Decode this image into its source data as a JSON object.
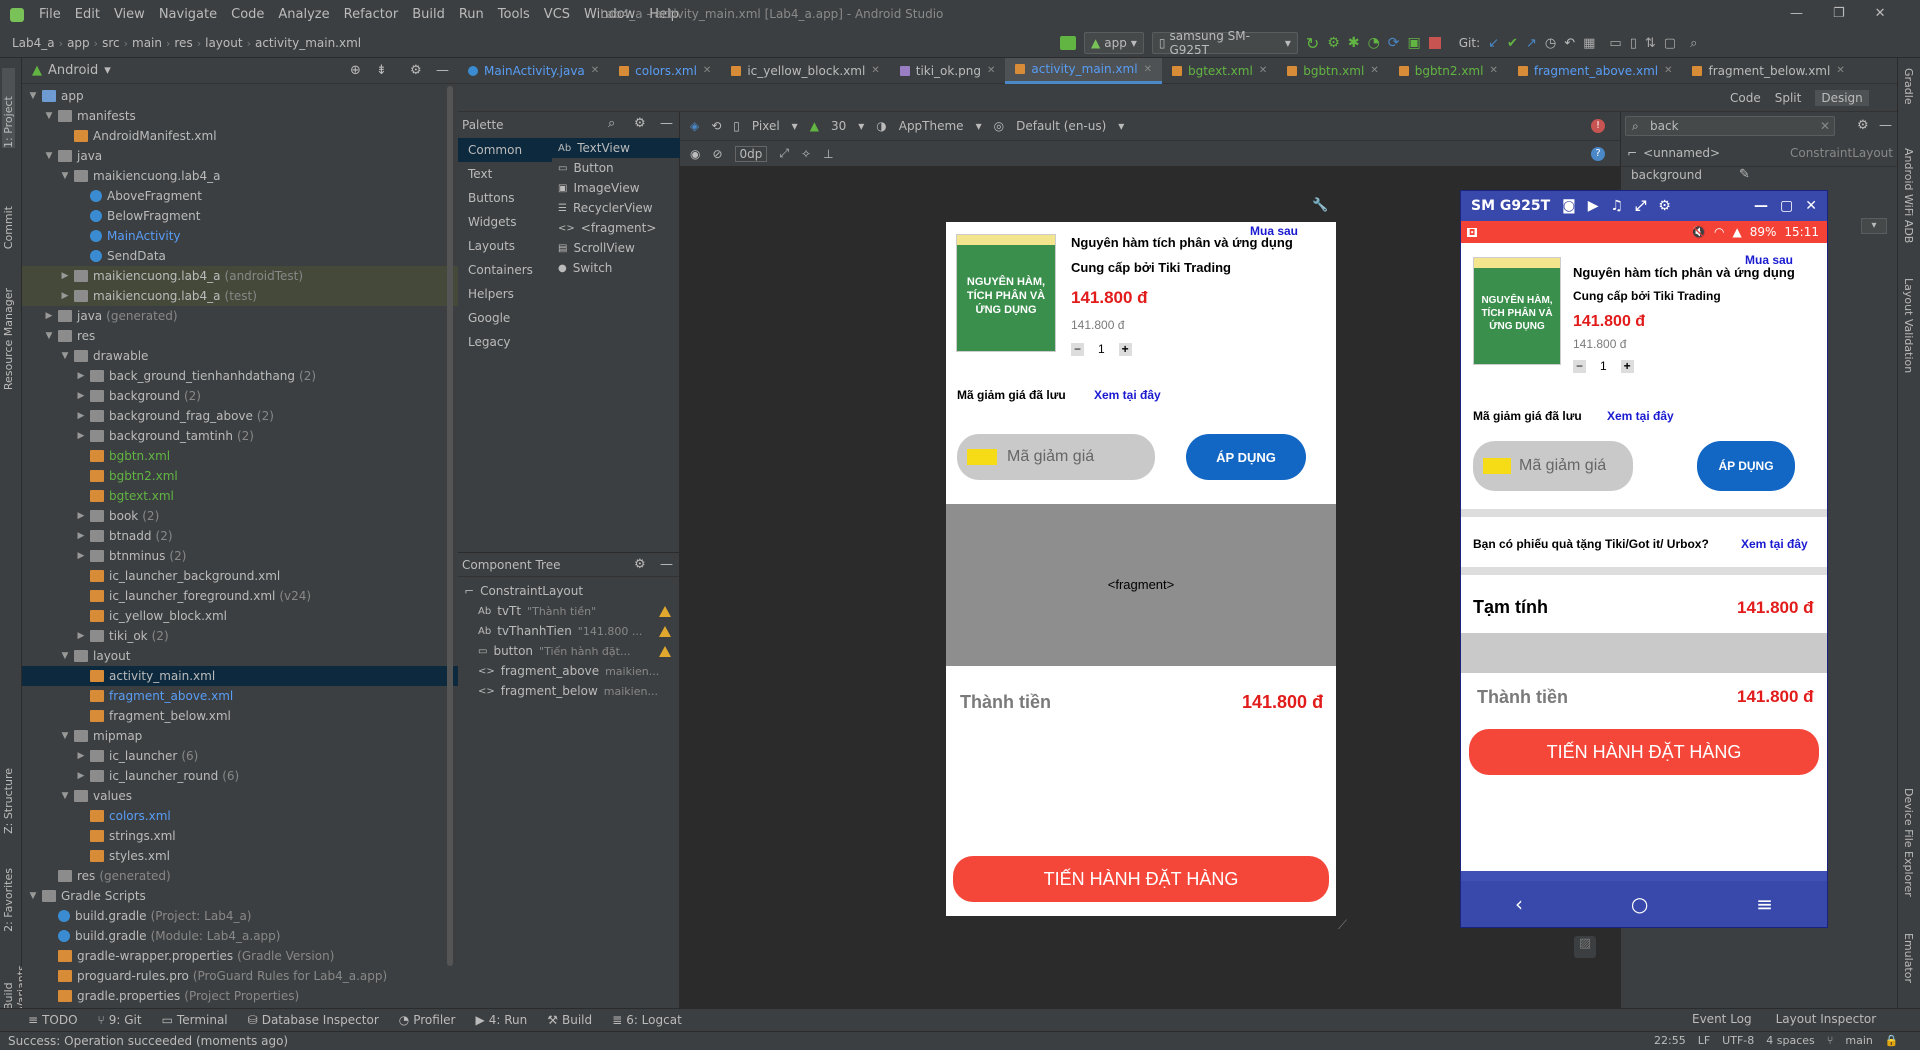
{
  "menu": [
    "File",
    "Edit",
    "View",
    "Navigate",
    "Code",
    "Analyze",
    "Refactor",
    "Build",
    "Run",
    "Tools",
    "VCS",
    "Window",
    "Help"
  ],
  "window_title": "Lab4_a - activity_main.xml [Lab4_a.app] - Android Studio",
  "breadcrumb": [
    "Lab4_a",
    "app",
    "src",
    "main",
    "res",
    "layout",
    "activity_main.xml"
  ],
  "toolbar": {
    "config": "app",
    "device": "samsung SM-G925T",
    "git": "Git:"
  },
  "project": {
    "view": "Android"
  },
  "tree": [
    {
      "d": 0,
      "a": "▼",
      "i": "fold blue",
      "t": "app",
      "n": ""
    },
    {
      "d": 1,
      "a": "▼",
      "i": "fold",
      "t": "manifests",
      "n": ""
    },
    {
      "d": 2,
      "a": "",
      "i": "xml",
      "t": "AndroidManifest.xml",
      "n": ""
    },
    {
      "d": 1,
      "a": "▼",
      "i": "fold",
      "t": "java",
      "n": ""
    },
    {
      "d": 2,
      "a": "▼",
      "i": "fold",
      "t": "maikiencuong.lab4_a",
      "n": ""
    },
    {
      "d": 3,
      "a": "",
      "i": "cls",
      "t": "AboveFragment",
      "n": ""
    },
    {
      "d": 3,
      "a": "",
      "i": "cls",
      "t": "BelowFragment",
      "n": ""
    },
    {
      "d": 3,
      "a": "",
      "i": "cls",
      "t": "MainActivity",
      "n": "",
      "c": "#589df6"
    },
    {
      "d": 3,
      "a": "",
      "i": "cls",
      "t": "SendData",
      "n": ""
    },
    {
      "d": 2,
      "a": "▶",
      "i": "fold",
      "t": "maikiencuong.lab4_a",
      "n": "(androidTest)",
      "bg": "#45493a"
    },
    {
      "d": 2,
      "a": "▶",
      "i": "fold",
      "t": "maikiencuong.lab4_a",
      "n": "(test)",
      "bg": "#45493a"
    },
    {
      "d": 1,
      "a": "▶",
      "i": "fold",
      "t": "java",
      "n": "(generated)"
    },
    {
      "d": 1,
      "a": "▼",
      "i": "fold",
      "t": "res",
      "n": ""
    },
    {
      "d": 2,
      "a": "▼",
      "i": "fold",
      "t": "drawable",
      "n": ""
    },
    {
      "d": 3,
      "a": "▶",
      "i": "fold",
      "t": "back_ground_tienhanhdathang",
      "n": "(2)"
    },
    {
      "d": 3,
      "a": "▶",
      "i": "fold",
      "t": "background",
      "n": "(2)"
    },
    {
      "d": 3,
      "a": "▶",
      "i": "fold",
      "t": "background_frag_above",
      "n": "(2)"
    },
    {
      "d": 3,
      "a": "▶",
      "i": "fold",
      "t": "background_tamtinh",
      "n": "(2)"
    },
    {
      "d": 3,
      "a": "",
      "i": "xml",
      "t": "bgbtn.xml",
      "n": "",
      "c": "#62b543"
    },
    {
      "d": 3,
      "a": "",
      "i": "xml",
      "t": "bgbtn2.xml",
      "n": "",
      "c": "#62b543"
    },
    {
      "d": 3,
      "a": "",
      "i": "xml",
      "t": "bgtext.xml",
      "n": "",
      "c": "#62b543"
    },
    {
      "d": 3,
      "a": "▶",
      "i": "fold",
      "t": "book",
      "n": "(2)"
    },
    {
      "d": 3,
      "a": "▶",
      "i": "fold",
      "t": "btnadd",
      "n": "(2)"
    },
    {
      "d": 3,
      "a": "▶",
      "i": "fold",
      "t": "btnminus",
      "n": "(2)"
    },
    {
      "d": 3,
      "a": "",
      "i": "xml",
      "t": "ic_launcher_background.xml",
      "n": ""
    },
    {
      "d": 3,
      "a": "",
      "i": "xml",
      "t": "ic_launcher_foreground.xml",
      "n": "(v24)"
    },
    {
      "d": 3,
      "a": "",
      "i": "xml",
      "t": "ic_yellow_block.xml",
      "n": ""
    },
    {
      "d": 3,
      "a": "▶",
      "i": "fold",
      "t": "tiki_ok",
      "n": "(2)"
    },
    {
      "d": 2,
      "a": "▼",
      "i": "fold",
      "t": "layout",
      "n": ""
    },
    {
      "d": 3,
      "a": "",
      "i": "xml",
      "t": "activity_main.xml",
      "n": "",
      "sel": true
    },
    {
      "d": 3,
      "a": "",
      "i": "xml",
      "t": "fragment_above.xml",
      "n": "",
      "c": "#589df6"
    },
    {
      "d": 3,
      "a": "",
      "i": "xml",
      "t": "fragment_below.xml",
      "n": ""
    },
    {
      "d": 2,
      "a": "▼",
      "i": "fold",
      "t": "mipmap",
      "n": ""
    },
    {
      "d": 3,
      "a": "▶",
      "i": "fold",
      "t": "ic_launcher",
      "n": "(6)"
    },
    {
      "d": 3,
      "a": "▶",
      "i": "fold",
      "t": "ic_launcher_round",
      "n": "(6)"
    },
    {
      "d": 2,
      "a": "▼",
      "i": "fold",
      "t": "values",
      "n": ""
    },
    {
      "d": 3,
      "a": "",
      "i": "xml",
      "t": "colors.xml",
      "n": "",
      "c": "#589df6"
    },
    {
      "d": 3,
      "a": "",
      "i": "xml",
      "t": "strings.xml",
      "n": ""
    },
    {
      "d": 3,
      "a": "",
      "i": "xml",
      "t": "styles.xml",
      "n": ""
    },
    {
      "d": 1,
      "a": "",
      "i": "fold",
      "t": "res",
      "n": "(generated)"
    },
    {
      "d": 0,
      "a": "▼",
      "i": "fold",
      "t": "Gradle Scripts",
      "n": ""
    },
    {
      "d": 1,
      "a": "",
      "i": "cls",
      "t": "build.gradle",
      "n": "(Project: Lab4_a)"
    },
    {
      "d": 1,
      "a": "",
      "i": "cls",
      "t": "build.gradle",
      "n": "(Module: Lab4_a.app)"
    },
    {
      "d": 1,
      "a": "",
      "i": "xml",
      "t": "gradle-wrapper.properties",
      "n": "(Gradle Version)"
    },
    {
      "d": 1,
      "a": "",
      "i": "xml",
      "t": "proguard-rules.pro",
      "n": "(ProGuard Rules for Lab4_a.app)"
    },
    {
      "d": 1,
      "a": "",
      "i": "xml",
      "t": "gradle.properties",
      "n": "(Project Properties)"
    }
  ],
  "tabs": [
    "MainActivity.java",
    "colors.xml",
    "ic_yellow_block.xml",
    "tiki_ok.png",
    "activity_main.xml",
    "bgtext.xml",
    "bgbtn.xml",
    "bgbtn2.xml",
    "fragment_above.xml",
    "fragment_below.xml"
  ],
  "active_tab": 4,
  "modes": {
    "code": "Code",
    "split": "Split",
    "design": "Design"
  },
  "palette": {
    "title": "Palette",
    "cats": [
      "Common",
      "Text",
      "Buttons",
      "Widgets",
      "Layouts",
      "Containers",
      "Helpers",
      "Google",
      "Legacy"
    ],
    "items": [
      "TextView",
      "Button",
      "ImageView",
      "RecyclerView",
      "<fragment>",
      "ScrollView",
      "Switch"
    ]
  },
  "design_toolbar": {
    "device": "Pixel",
    "api": "30",
    "theme": "AppTheme",
    "locale": "Default (en-us)",
    "margin": "0dp"
  },
  "search": {
    "value": "back"
  },
  "attrs": {
    "unnamed": "<unnamed>",
    "layout": "ConstraintLayout",
    "attr": "background"
  },
  "comp_tree": {
    "title": "Component Tree",
    "root": "ConstraintLayout",
    "items": [
      {
        "t": "tvTt",
        "v": "\"Thành tiền\"",
        "w": true
      },
      {
        "t": "tvThanhTien",
        "v": "\"141.800 ...",
        "w": true
      },
      {
        "t": "button",
        "v": "\"Tiến hành đặt...",
        "w": true
      },
      {
        "t": "fragment_above",
        "v": "maikien...",
        "w": false
      },
      {
        "t": "fragment_below",
        "v": "maikien...",
        "w": false
      }
    ]
  },
  "shop": {
    "buy_later": "Mua sau",
    "name": "Nguyên hàm tích phân và ứng dụng",
    "vendor": "Cung cấp bởi Tiki Trading",
    "price": "141.800 đ",
    "old_price": "141.800 đ",
    "qty": "1",
    "coupon_saved": "Mã giảm giá đã lưu",
    "see_here": "Xem tại đây",
    "coupon_ph": "Mã giảm giá",
    "apply": "ÁP DỤNG",
    "fragment": "<fragment>",
    "total_label": "Thành tiền",
    "total": "141.800 đ",
    "checkout": "TIẾN HÀNH ĐẶT HÀNG",
    "gift": "Bạn có phiếu quà tặng Tiki/Got it/ Urbox?",
    "subtotal_label": "Tạm tính",
    "subtotal": "141.800 đ",
    "book_title": "NGUYÊN HÀM, TÍCH PHÂN VÀ ỨNG DỤNG"
  },
  "emulator": {
    "title": "SM G925T",
    "battery": "89%",
    "time": "15:11"
  },
  "bottom_tools": [
    "TODO",
    "9: Git",
    "Terminal",
    "Database Inspector",
    "Profiler",
    "4: Run",
    "Build",
    "6: Logcat"
  ],
  "bottom_right": [
    "Event Log",
    "Layout Inspector"
  ],
  "status": {
    "msg": "Success: Operation succeeded (moments ago)",
    "pos": "22:55",
    "le": "LF",
    "enc": "UTF-8",
    "indent": "4 spaces",
    "branch": "main"
  },
  "left_tabs": [
    "1: Project",
    "Commit",
    "Resource Manager",
    "Z: Structure",
    "2: Favorites",
    "Build Variants"
  ],
  "right_tabs": [
    "Gradle",
    "Android WiFi ADB",
    "Layout Validation",
    "Device File Explorer",
    "Emulator"
  ]
}
